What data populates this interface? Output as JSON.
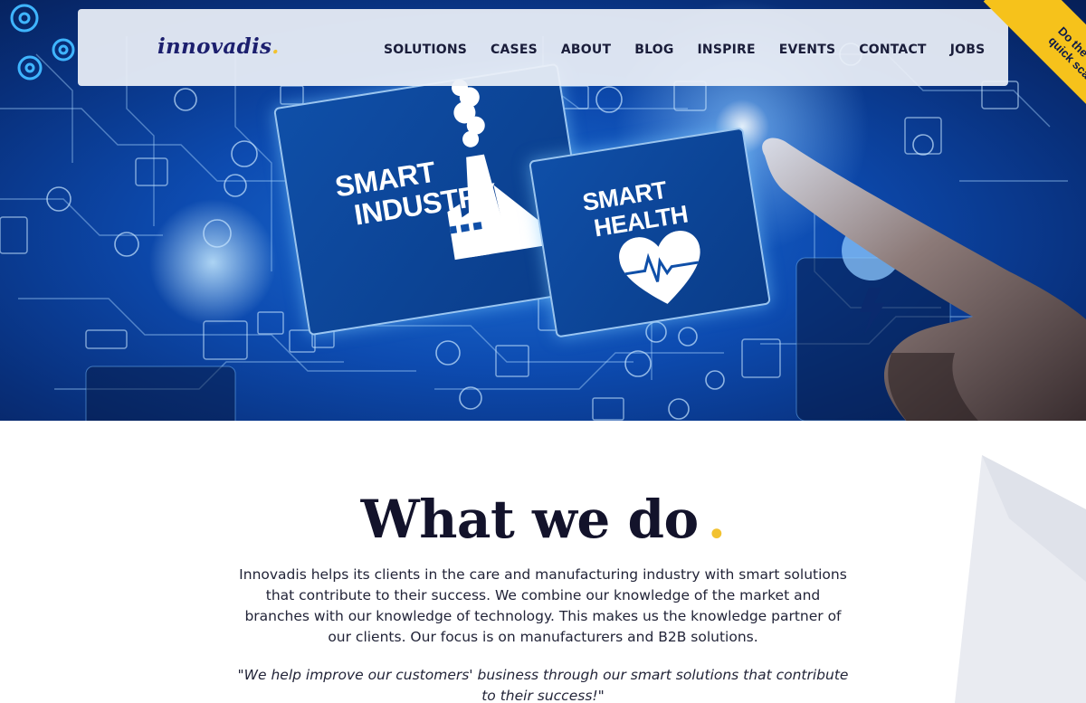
{
  "brand": {
    "logo_text": "innovadis",
    "logo_dot": "."
  },
  "nav": {
    "items": [
      "SOLUTIONS",
      "CASES",
      "ABOUT",
      "BLOG",
      "INSPIRE",
      "EVENTS",
      "CONTACT",
      "JOBS"
    ]
  },
  "ribbon": {
    "line1": "Do the PIM",
    "line2": "quick scan"
  },
  "hero": {
    "tile_industry": {
      "line1": "SMART",
      "line2": "INDUSTRY"
    },
    "tile_health": {
      "line1": "SMART",
      "line2": "HEALTH"
    }
  },
  "section": {
    "title": "What we do",
    "title_dot": ".",
    "intro": "Innovadis helps its clients in the care and manufacturing industry with smart solutions that contribute to their success. We combine our knowledge of the market and branches with our knowledge of technology. This makes us the knowledge partner of our clients. Our focus is on manufacturers and B2B solutions.",
    "quote": "\"We help improve our customers' business through our smart solutions that contribute to their success!\""
  },
  "colors": {
    "accent_yellow": "#f2c230",
    "brand_navy": "#1c1f6e",
    "hero_blue": "#0d4bb0"
  }
}
